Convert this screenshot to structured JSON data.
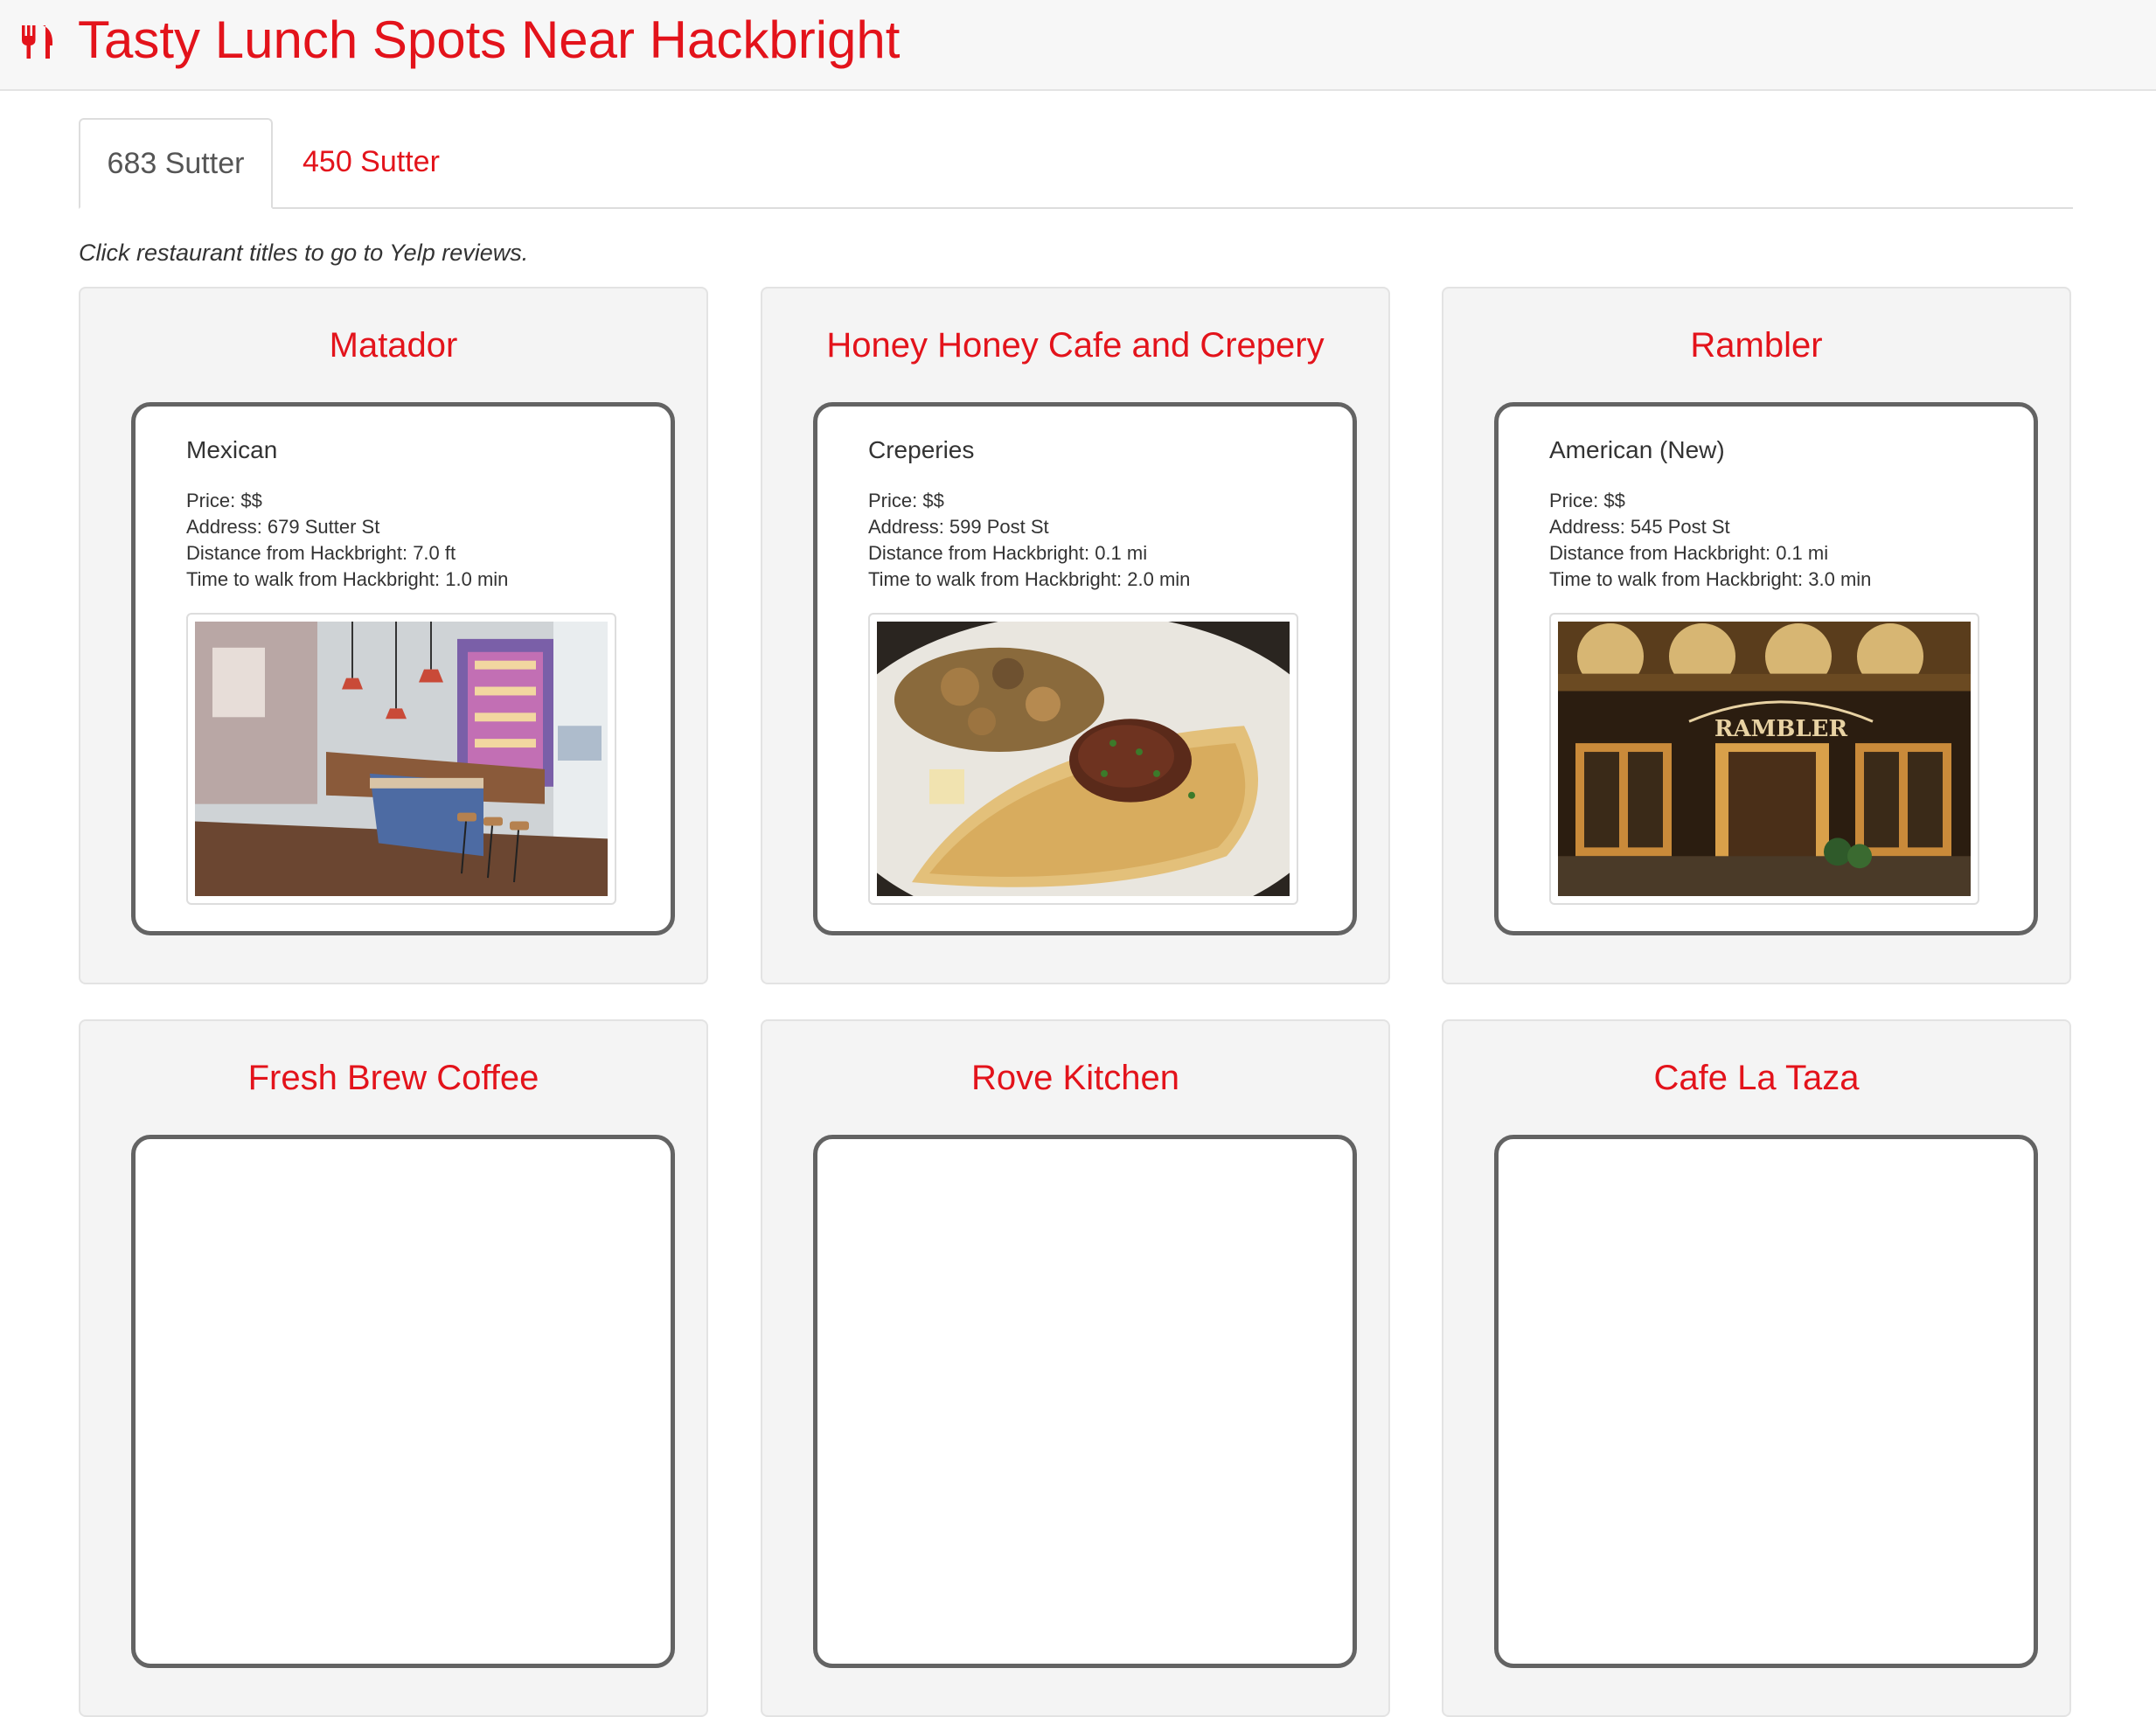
{
  "header": {
    "title": "Tasty Lunch Spots Near Hackbright",
    "icon": "fork-knife-icon",
    "accent_color": "#e3131b"
  },
  "tabs": [
    {
      "label": "683 Sutter",
      "active": true
    },
    {
      "label": "450 Sutter",
      "active": false
    }
  ],
  "hint": "Click restaurant titles to go to Yelp reviews.",
  "restaurants": [
    {
      "name": "Matador",
      "category": "Mexican",
      "price": "Price: $$",
      "address": "Address: 679 Sutter St",
      "distance": "Distance from Hackbright: 7.0 ft",
      "walk_time": "Time to walk from Hackbright: 1.0 min",
      "photo": "restaurant-interior-photo"
    },
    {
      "name": "Honey Honey Cafe and Crepery",
      "category": "Creperies",
      "price": "Price: $$",
      "address": "Address: 599 Post St",
      "distance": "Distance from Hackbright: 0.1 mi",
      "walk_time": "Time to walk from Hackbright: 2.0 min",
      "photo": "crepe-dish-photo"
    },
    {
      "name": "Rambler",
      "category": "American (New)",
      "price": "Price: $$",
      "address": "Address: 545 Post St",
      "distance": "Distance from Hackbright: 0.1 mi",
      "walk_time": "Time to walk from Hackbright: 3.0 min",
      "photo": "storefront-night-photo",
      "photo_sign_text": "RAMBLER"
    },
    {
      "name": "Fresh Brew Coffee"
    },
    {
      "name": "Rove Kitchen"
    },
    {
      "name": "Cafe La Taza"
    }
  ]
}
